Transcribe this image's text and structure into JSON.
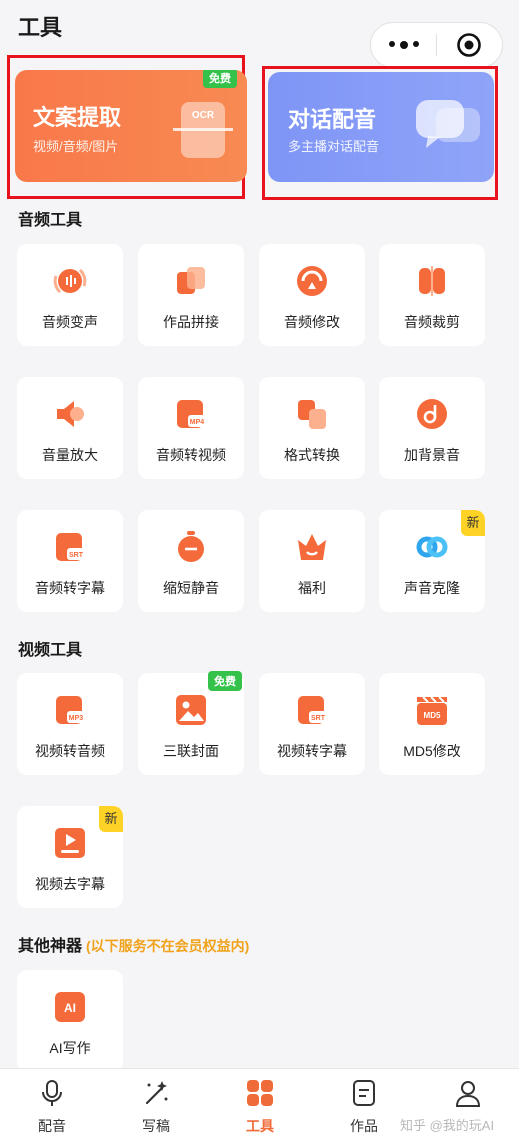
{
  "header": {
    "title": "工具"
  },
  "banners": [
    {
      "title": "文案提取",
      "subtitle": "视频/音频/图片",
      "badge": "免费",
      "icon_text": "OCR",
      "icon": "ocr-scanner-icon",
      "color": "#f77e47"
    },
    {
      "title": "对话配音",
      "subtitle": "多主播对话配音",
      "icon": "chat-bubbles-icon",
      "color": "#8499f6"
    }
  ],
  "sections": {
    "audio": {
      "title": "音频工具",
      "items": [
        {
          "label": "音频变声",
          "icon": "voice-change-icon"
        },
        {
          "label": "作品拼接",
          "icon": "splice-icon"
        },
        {
          "label": "音频修改",
          "icon": "audio-edit-icon"
        },
        {
          "label": "音频裁剪",
          "icon": "audio-cut-icon"
        },
        {
          "label": "音量放大",
          "icon": "volume-up-icon"
        },
        {
          "label": "音频转视频",
          "icon": "mp4-file-icon",
          "icon_text": "MP4"
        },
        {
          "label": "格式转换",
          "icon": "format-convert-icon"
        },
        {
          "label": "加背景音",
          "icon": "music-note-icon"
        },
        {
          "label": "音频转字幕",
          "icon": "srt-file-icon",
          "icon_text": "SRT"
        },
        {
          "label": "缩短静音",
          "icon": "timer-icon"
        },
        {
          "label": "福利",
          "icon": "crown-icon"
        },
        {
          "label": "声音克隆",
          "icon": "clone-loop-icon",
          "badge": "新"
        }
      ]
    },
    "video": {
      "title": "视频工具",
      "items": [
        {
          "label": "视频转音频",
          "icon": "mp3-file-icon",
          "icon_text": "MP3"
        },
        {
          "label": "三联封面",
          "icon": "image-icon",
          "badge": "免费"
        },
        {
          "label": "视频转字幕",
          "icon": "srt-file-icon",
          "icon_text": "SRT"
        },
        {
          "label": "MD5修改",
          "icon": "clapper-icon",
          "icon_text": "MD5"
        },
        {
          "label": "视频去字幕",
          "icon": "video-remove-subtitle-icon",
          "badge": "新"
        }
      ]
    },
    "other": {
      "title": "其他神器",
      "note": "(以下服务不在会员权益内)",
      "items": [
        {
          "label": "AI写作",
          "icon": "ai-icon",
          "icon_text": "AI"
        }
      ]
    }
  },
  "tabbar": [
    {
      "label": "配音",
      "icon": "microphone-icon"
    },
    {
      "label": "写稿",
      "icon": "magic-pen-icon"
    },
    {
      "label": "工具",
      "icon": "grid-icon",
      "active": true
    },
    {
      "label": "作品",
      "icon": "document-icon"
    },
    {
      "label": "",
      "icon": "user-icon"
    }
  ],
  "watermark": "知乎 @我的玩AI",
  "colors": {
    "accent": "#f06b3a",
    "highlight": "#e8121c",
    "new_badge": "#ffd326",
    "free_badge": "#35c24a"
  }
}
